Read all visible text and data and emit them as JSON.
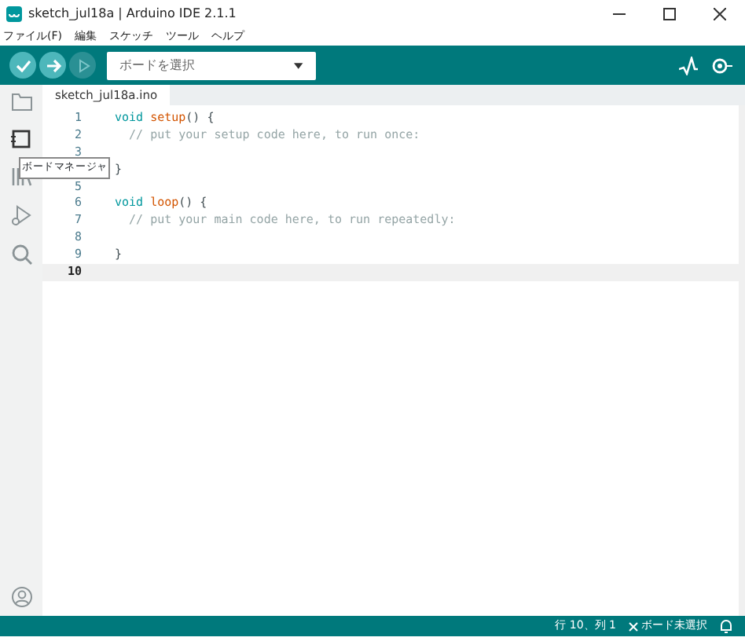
{
  "window": {
    "title": "sketch_jul18a | Arduino IDE 2.1.1"
  },
  "menu": [
    "ファイル(F)",
    "編集",
    "スケッチ",
    "ツール",
    "ヘルプ"
  ],
  "toolbar": {
    "board_select": {
      "placeholder": "ボードを選択"
    }
  },
  "sidebar": {
    "tooltip": "ボードマネージャ"
  },
  "tabs": [
    {
      "label": "sketch_jul18a.ino",
      "selected": true
    }
  ],
  "editor": {
    "lines": [
      {
        "number": "1",
        "selected": false,
        "tokens": [
          {
            "kind": "keyword",
            "text": "void"
          },
          {
            "kind": "function",
            "text": " setup"
          },
          {
            "kind": "plain",
            "text": "() {"
          }
        ]
      },
      {
        "number": "2",
        "selected": false,
        "tokens": [
          {
            "kind": "comment",
            "text": "  // put your setup code here, to run once:"
          }
        ]
      },
      {
        "number": "3",
        "selected": false
      },
      {
        "selected": false,
        "tokens": [
          {
            "kind": "plain",
            "text": "}"
          }
        ]
      },
      {
        "number": "5",
        "selected": false
      },
      {
        "number": "6",
        "selected": false,
        "tokens": [
          {
            "kind": "keyword",
            "text": "void"
          },
          {
            "kind": "function",
            "text": " loop"
          },
          {
            "kind": "plain",
            "text": "() {"
          }
        ]
      },
      {
        "number": "7",
        "selected": false,
        "tokens": [
          {
            "kind": "comment",
            "text": "  // put your main code here, to run repeatedly:"
          }
        ]
      },
      {
        "number": "8",
        "selected": false
      },
      {
        "number": "9",
        "selected": false,
        "tokens": [
          {
            "kind": "plain",
            "text": "}"
          }
        ]
      },
      {
        "number": "10",
        "selected": true
      }
    ]
  },
  "status_bar": {
    "position": "行 10、列 1",
    "board": "ボード未選択"
  }
}
